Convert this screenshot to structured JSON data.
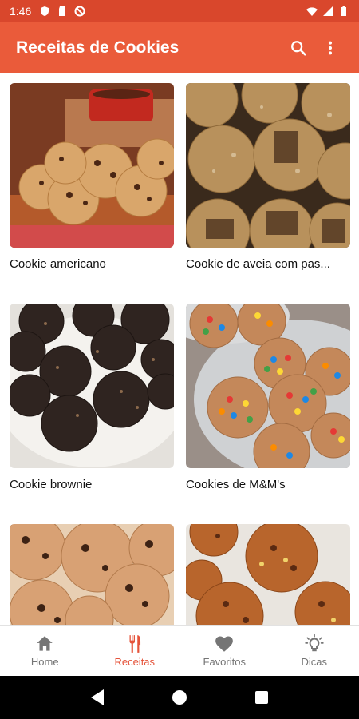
{
  "status_bar": {
    "time": "1:46"
  },
  "app_bar": {
    "title": "Receitas de Cookies",
    "search_icon": "search-icon",
    "menu_icon": "more-vert-icon"
  },
  "recipes": [
    {
      "title": "Cookie americano"
    },
    {
      "title": "Cookie de aveia com pas..."
    },
    {
      "title": "Cookie brownie"
    },
    {
      "title": "Cookies de M&M's"
    },
    {
      "title": ""
    },
    {
      "title": ""
    }
  ],
  "bottom_nav": [
    {
      "label": "Home",
      "icon": "home-icon",
      "active": false
    },
    {
      "label": "Receitas",
      "icon": "utensils-icon",
      "active": true
    },
    {
      "label": "Favoritos",
      "icon": "heart-icon",
      "active": false
    },
    {
      "label": "Dicas",
      "icon": "lightbulb-icon",
      "active": false
    }
  ],
  "colors": {
    "status_bar": "#d9472c",
    "app_bar": "#ea5b3a",
    "accent": "#e5533a"
  }
}
